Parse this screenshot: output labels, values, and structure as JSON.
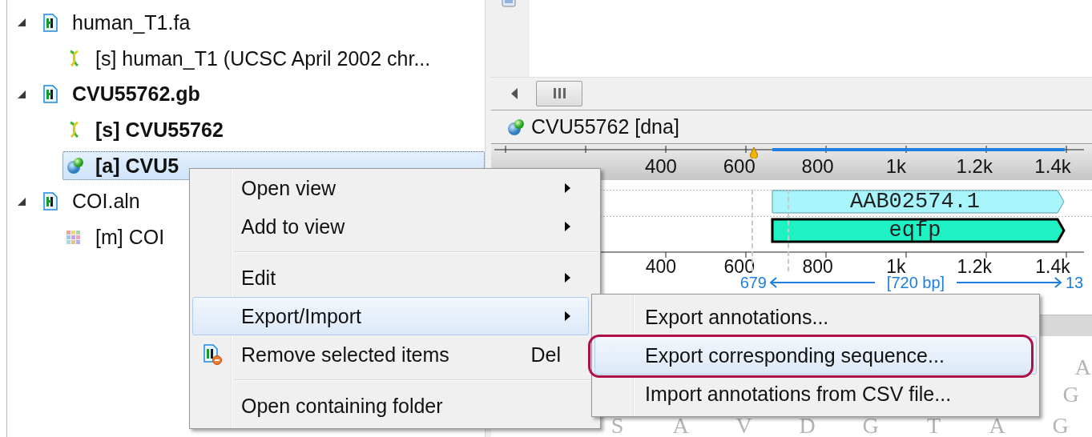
{
  "tree": [
    {
      "label": "human_T1.fa",
      "kind": "document",
      "bold": false,
      "expanded": true,
      "selected": false,
      "children": [
        {
          "label": "[s] human_T1 (UCSC April 2002 chr...",
          "kind": "sequence",
          "bold": false,
          "selected": false
        }
      ]
    },
    {
      "label": "CVU55762.gb",
      "kind": "document",
      "bold": true,
      "expanded": true,
      "selected": false,
      "children": [
        {
          "label": "[s] CVU55762",
          "kind": "sequence",
          "bold": true,
          "selected": false
        },
        {
          "label": "[a] CVU5",
          "kind": "annotations",
          "bold": true,
          "selected": true
        }
      ]
    },
    {
      "label": "COI.aln",
      "kind": "document",
      "bold": false,
      "expanded": true,
      "selected": false,
      "children": [
        {
          "label": "[m] COI",
          "kind": "alignment",
          "bold": false,
          "selected": false
        }
      ]
    }
  ],
  "sequence_view": {
    "title": "CVU55762 [dna]",
    "top_ruler": [
      "400",
      "600",
      "800",
      "1k",
      "1.2k",
      "1.4k"
    ],
    "features": [
      {
        "label": "AAB02574.1",
        "color": "#a8f4fb",
        "selected": false
      },
      {
        "label": "eqfp",
        "color": "#1ff3c6",
        "selected": true
      }
    ],
    "bottom_ruler": [
      "400",
      "600",
      "800",
      "1k",
      "1.2k",
      "1.4k"
    ],
    "range": {
      "start": "679",
      "length": "[720 bp]",
      "end": "13"
    },
    "sequence_rows": [
      [
        "A"
      ],
      [
        "G"
      ],
      [
        "S",
        "A",
        "V",
        "D",
        "G",
        "T",
        "A",
        "G"
      ]
    ]
  },
  "context_menu": [
    {
      "kind": "item",
      "label": "Open view",
      "submenu": true,
      "has_icon": false,
      "selected": false
    },
    {
      "kind": "item",
      "label": "Add to view",
      "submenu": true,
      "has_icon": false,
      "selected": false
    },
    {
      "kind": "separator"
    },
    {
      "kind": "item",
      "label": "Edit",
      "submenu": true,
      "has_icon": false,
      "selected": false
    },
    {
      "kind": "item",
      "label": "Export/Import",
      "submenu": true,
      "has_icon": false,
      "selected": true
    },
    {
      "kind": "item",
      "label": "Remove selected items",
      "shortcut": "Del",
      "submenu": false,
      "has_icon": true,
      "selected": false
    },
    {
      "kind": "separator"
    },
    {
      "kind": "item",
      "label": "Open containing folder",
      "submenu": false,
      "has_icon": false,
      "selected": false
    }
  ],
  "submenu": [
    {
      "label": "Export annotations...",
      "selected": false,
      "callout": false
    },
    {
      "label": "Export corresponding sequence...",
      "selected": true,
      "callout": true
    },
    {
      "label": "Import annotations from CSV file...",
      "selected": false,
      "callout": false
    }
  ]
}
